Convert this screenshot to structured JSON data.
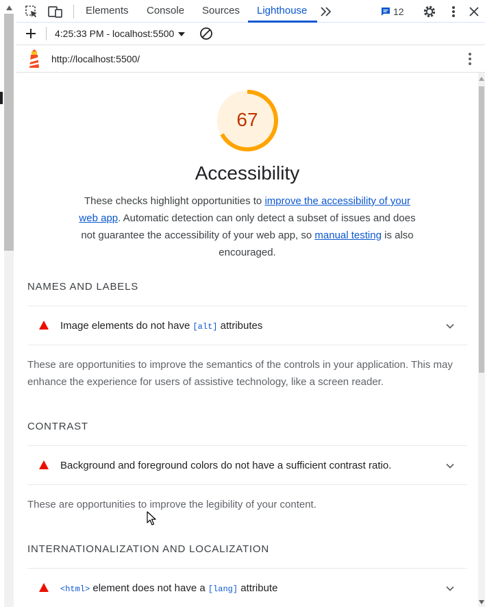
{
  "devtools": {
    "tabs": [
      {
        "label": "Elements"
      },
      {
        "label": "Console"
      },
      {
        "label": "Sources"
      },
      {
        "label": "Lighthouse",
        "active": true
      }
    ],
    "issues_count": "12",
    "accent_color": "#0b57d0"
  },
  "lighthouse_toolbar": {
    "report_selector": "4:25:33 PM - localhost:5500"
  },
  "url_bar": {
    "url": "http://localhost:5500/"
  },
  "category": {
    "score": "67",
    "score_fraction": 0.67,
    "score_color": "#ffa400",
    "title": "Accessibility",
    "description": {
      "part1": "These checks highlight opportunities to ",
      "link1": "improve the accessibility of your web app",
      "part2": ". Automatic detection can only detect a subset of issues and does not guarantee the accessibility of your web app, so ",
      "link2": "manual testing",
      "part3": " is also encouraged."
    }
  },
  "groups": [
    {
      "title": "NAMES AND LABELS",
      "audit": {
        "pre": "Image elements do not have ",
        "code": "[alt]",
        "post": " attributes"
      },
      "description": "These are opportunities to improve the semantics of the controls in your application. This may enhance the experience for users of assistive technology, like a screen reader."
    },
    {
      "title": "CONTRAST",
      "audit": {
        "pre": "Background and foreground colors do not have a sufficient contrast ratio.",
        "code": "",
        "post": ""
      },
      "description": "These are opportunities to improve the legibility of your content."
    },
    {
      "title": "INTERNATIONALIZATION AND LOCALIZATION",
      "audit": {
        "code1": "<html>",
        "mid": " element does not have a ",
        "code2": "[lang]",
        "post": " attribute"
      }
    }
  ],
  "icons": {
    "fail": "red-triangle-icon",
    "fail_color": "#eb0f00"
  }
}
